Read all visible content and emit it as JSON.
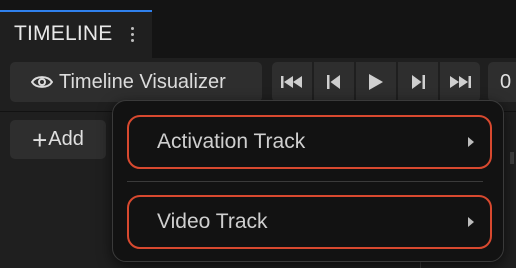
{
  "panel": {
    "title": "TIMELINE"
  },
  "toolbar": {
    "visualizer_label": "Timeline Visualizer",
    "frame_value": "0",
    "add_label": "Add"
  },
  "context_menu": {
    "items": [
      {
        "label": "Activation Track"
      },
      {
        "label": "Video Track"
      }
    ]
  },
  "colors": {
    "accent": "#2f80ed",
    "highlight_outline": "#d8492f",
    "background": "#1f1f1f"
  }
}
